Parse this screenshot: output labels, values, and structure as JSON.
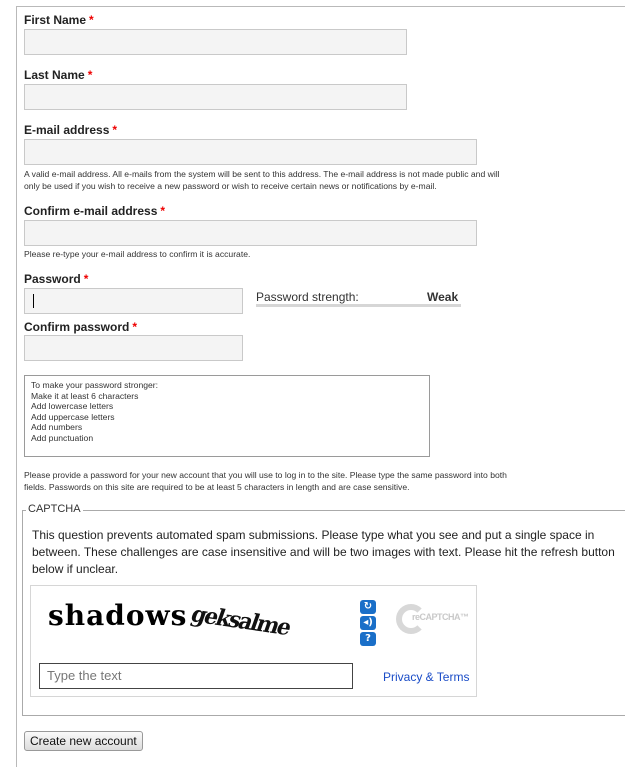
{
  "first_name": {
    "label": "First Name",
    "required_marker": "*",
    "value": ""
  },
  "last_name": {
    "label": "Last Name",
    "required_marker": "*",
    "value": ""
  },
  "email": {
    "label": "E-mail address",
    "required_marker": "*",
    "value": "",
    "description_1": "A valid e-mail address. All e-mails from the system will be sent to this address. The e-mail address is not made public and will",
    "description_2": "only be used if you wish to receive a new password or wish to receive certain news or notifications by e-mail."
  },
  "confirm_email": {
    "label": "Confirm e-mail address",
    "required_marker": "*",
    "value": "",
    "description": "Please re-type your e-mail address to confirm it is accurate."
  },
  "password": {
    "label": "Password",
    "required_marker": "*",
    "value": "",
    "strength_label": "Password strength:",
    "strength_value": "Weak"
  },
  "confirm_password": {
    "label": "Confirm password",
    "required_marker": "*",
    "value": ""
  },
  "password_tips": {
    "title": "To make your password stronger:",
    "items": [
      "Make it at least 6 characters",
      "Add lowercase letters",
      "Add uppercase letters",
      "Add numbers",
      "Add punctuation"
    ]
  },
  "password_help_1": "Please provide a password for your new account that you will use to log in to the site. Please type the same password into both",
  "password_help_2": "fields. Passwords on this site are required to be at least 5 characters in length and are case sensitive.",
  "captcha": {
    "legend": "CAPTCHA",
    "description": "This question prevents automated spam submissions. Please type what you see and put a single space in between. These challenges are case insensitive and will be two images with text. Please hit the refresh button below if unclear.",
    "word_1": "shadows",
    "word_2": "geksalme",
    "input_placeholder": "Type the text",
    "privacy_link": "Privacy & Terms",
    "logo_text": "reCAPTCHA™",
    "refresh_icon": "refresh-icon",
    "audio_icon": "audio-icon",
    "help_icon": "help-icon"
  },
  "submit_label": "Create new account",
  "colors": {
    "required": "#ee0000",
    "input_bg": "#f4f4f4",
    "link": "#1a4cc7",
    "recaptcha_blue": "#1a6fc8"
  }
}
